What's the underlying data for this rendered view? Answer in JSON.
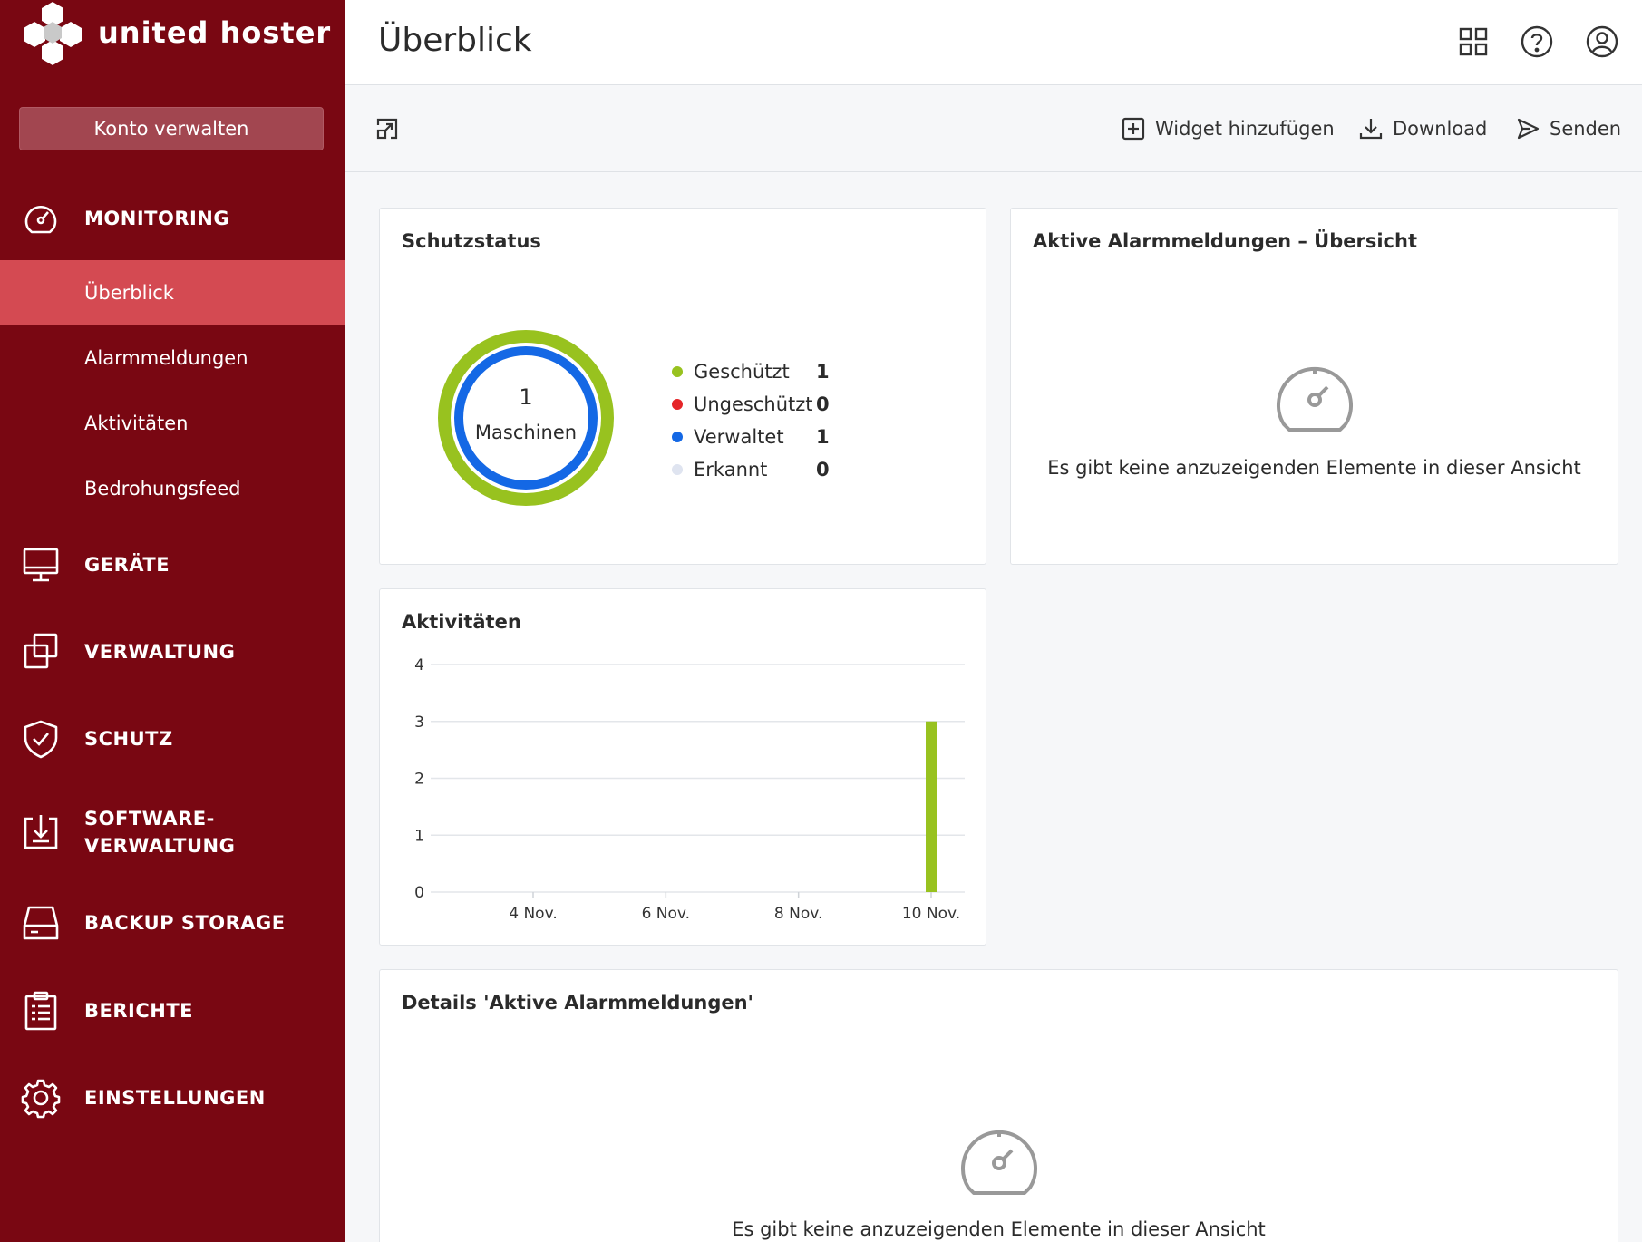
{
  "brand": {
    "name": "united hoster"
  },
  "sidebar": {
    "account_button": "Konto verwalten",
    "sections": [
      {
        "label": "MONITORING",
        "icon": "speedometer-icon"
      },
      {
        "label": "GERÄTE",
        "icon": "monitor-icon"
      },
      {
        "label": "VERWALTUNG",
        "icon": "copy-icon"
      },
      {
        "label": "SCHUTZ",
        "icon": "shield-check-icon"
      },
      {
        "label_line1": "SOFTWARE-",
        "label_line2": "VERWALTUNG",
        "icon": "software-download-icon"
      },
      {
        "label": "BACKUP STORAGE",
        "icon": "storage-drive-icon"
      },
      {
        "label": "BERICHTE",
        "icon": "clipboard-icon"
      },
      {
        "label": "EINSTELLUNGEN",
        "icon": "gear-icon"
      }
    ],
    "monitoring_items": [
      {
        "label": "Überblick",
        "active": true
      },
      {
        "label": "Alarmmeldungen",
        "active": false
      },
      {
        "label": "Aktivitäten",
        "active": false
      },
      {
        "label": "Bedrohungsfeed",
        "active": false
      }
    ]
  },
  "header": {
    "title": "Überblick",
    "icons": [
      "apps-grid-icon",
      "help-icon",
      "user-account-icon"
    ]
  },
  "toolbar": {
    "expand_icon": "expand-icon",
    "add_widget": "Widget hinzufügen",
    "download": "Download",
    "send": "Senden"
  },
  "widgets": {
    "protection": {
      "title": "Schutzstatus",
      "total": "1",
      "total_label": "Maschinen",
      "legend": [
        {
          "label": "Geschützt",
          "value": "1",
          "color": "#98c21f"
        },
        {
          "label": "Ungeschützt",
          "value": "0",
          "color": "#e52528"
        },
        {
          "label": "Verwaltet",
          "value": "1",
          "color": "#1468e5"
        },
        {
          "label": "Erkannt",
          "value": "0",
          "color": "#dfe4f0"
        }
      ]
    },
    "alerts_overview": {
      "title": "Aktive Alarmmeldungen – Übersicht",
      "empty_text": "Es gibt keine anzuzeigenden Elemente in dieser Ansicht"
    },
    "activities": {
      "title": "Aktivitäten"
    },
    "alerts_details": {
      "title": "Details 'Aktive Alarmmeldungen'",
      "empty_text": "Es gibt keine anzuzeigenden Elemente in dieser Ansicht"
    }
  },
  "chart_data": {
    "type": "bar",
    "title": "Aktivitäten",
    "x_ticks": [
      "4 Nov.",
      "6 Nov.",
      "8 Nov.",
      "10 Nov."
    ],
    "y_ticks": [
      "0",
      "1",
      "2",
      "3",
      "4"
    ],
    "ylim": [
      0,
      4
    ],
    "grid": true,
    "series": [
      {
        "x": "10 Nov.",
        "values": [
          3
        ],
        "color": "#98c21f"
      }
    ]
  }
}
